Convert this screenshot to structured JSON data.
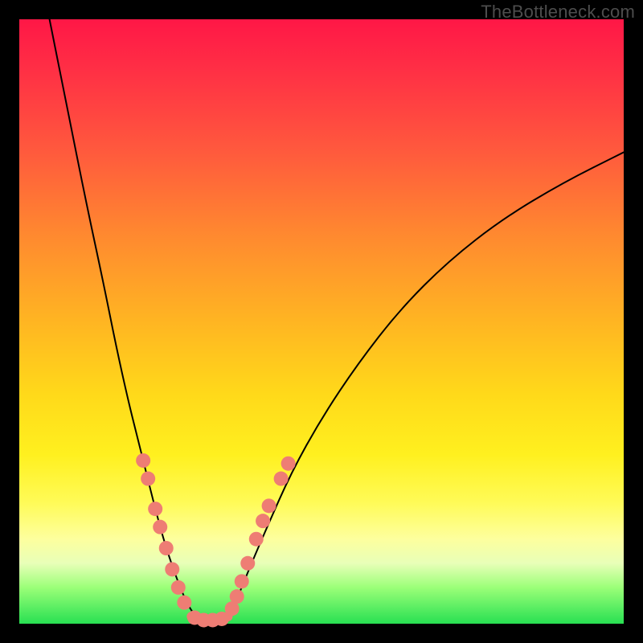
{
  "watermark": "TheBottleneck.com",
  "chart_data": {
    "type": "line",
    "title": "",
    "xlabel": "",
    "ylabel": "",
    "xlim": [
      0,
      100
    ],
    "ylim": [
      0,
      100
    ],
    "grid": false,
    "legend": false,
    "series": [
      {
        "name": "left-branch",
        "x": [
          5,
          8,
          11,
          14,
          16,
          18,
          19.5,
          21,
          22.5,
          24,
          25.5,
          27,
          28.5,
          30
        ],
        "y": [
          100,
          85,
          70,
          56,
          46,
          37,
          31,
          25,
          19,
          13.5,
          9,
          5,
          2,
          0.5
        ]
      },
      {
        "name": "right-branch",
        "x": [
          34,
          36,
          38,
          41,
          45,
          50,
          56,
          63,
          71,
          80,
          90,
          100
        ],
        "y": [
          0.5,
          4,
          9,
          16,
          25,
          34,
          43,
          52,
          60,
          67,
          73,
          78
        ]
      },
      {
        "name": "valley-floor",
        "x": [
          28.5,
          30,
          31.5,
          33,
          34.5
        ],
        "y": [
          1.2,
          0.6,
          0.5,
          0.6,
          1.2
        ]
      }
    ],
    "markers": {
      "left_cluster": [
        {
          "x": 20.5,
          "y": 27
        },
        {
          "x": 21.3,
          "y": 24
        },
        {
          "x": 22.5,
          "y": 19
        },
        {
          "x": 23.3,
          "y": 16
        },
        {
          "x": 24.3,
          "y": 12.5
        },
        {
          "x": 25.3,
          "y": 9
        },
        {
          "x": 26.3,
          "y": 6
        },
        {
          "x": 27.3,
          "y": 3.5
        }
      ],
      "right_cluster": [
        {
          "x": 35.2,
          "y": 2.5
        },
        {
          "x": 36.0,
          "y": 4.5
        },
        {
          "x": 36.8,
          "y": 7
        },
        {
          "x": 37.8,
          "y": 10
        },
        {
          "x": 39.2,
          "y": 14
        },
        {
          "x": 40.3,
          "y": 17
        },
        {
          "x": 41.3,
          "y": 19.5
        },
        {
          "x": 43.3,
          "y": 24
        },
        {
          "x": 44.5,
          "y": 26.5
        }
      ],
      "floor_cluster": [
        {
          "x": 29.0,
          "y": 1.0
        },
        {
          "x": 30.5,
          "y": 0.6
        },
        {
          "x": 32.0,
          "y": 0.6
        },
        {
          "x": 33.5,
          "y": 0.8
        }
      ]
    },
    "colors": {
      "curve": "#000000",
      "marker_fill": "#ee7d74",
      "marker_stroke": "#ee7d74",
      "background_top": "#ff1746",
      "background_bottom": "#28e052"
    }
  }
}
